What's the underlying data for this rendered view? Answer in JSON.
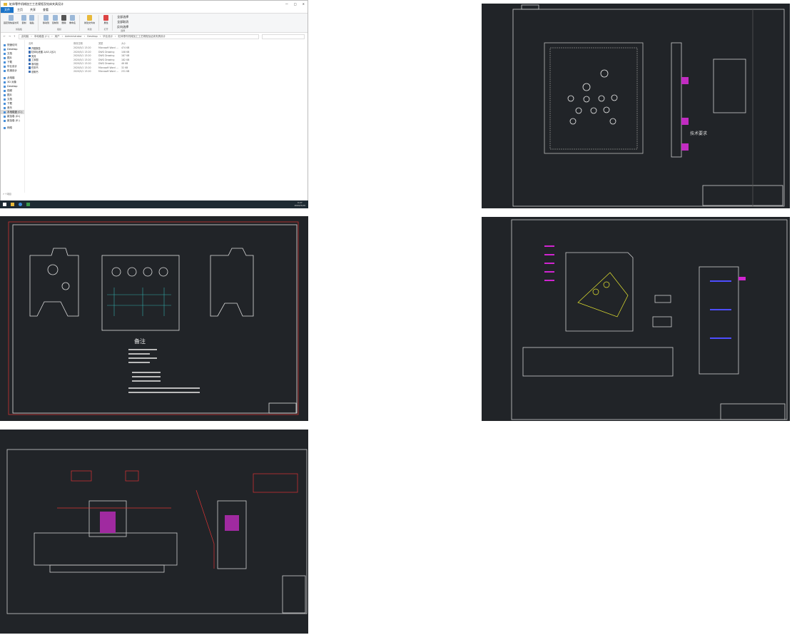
{
  "explorer": {
    "title": "缸体零件机械加工工艺规程及钻床夹具设计",
    "window_controls": [
      "—",
      "□",
      "✕"
    ],
    "menu": [
      "文件",
      "主页",
      "共享",
      "查看"
    ],
    "ribbon_groups": [
      {
        "label": "剪贴板",
        "buttons": [
          "固定到快速访问",
          "复制",
          "粘贴"
        ]
      },
      {
        "label": "组织",
        "buttons": [
          "移动到",
          "复制到",
          "删除",
          "重命名"
        ]
      },
      {
        "label": "新建",
        "buttons": [
          "新建文件夹"
        ]
      },
      {
        "label": "打开",
        "buttons": [
          "属性"
        ]
      },
      {
        "label": "选择",
        "buttons": [
          "全部选择",
          "全部取消",
          "反向选择"
        ]
      }
    ],
    "breadcrumb": [
      "此电脑",
      "本地磁盘 (C:)",
      "用户",
      "Administrator",
      "Desktop",
      "毕业设计"
    ],
    "nav": [
      "快速访问",
      "Desktop",
      "文档",
      "图片",
      "下载",
      "毕业设计",
      "机械设计",
      "此电脑",
      "3D 对象",
      "Desktop",
      "视频",
      "图片",
      "文档",
      "下载",
      "音乐",
      "本地磁盘 (C:)",
      "新加卷 (D:)",
      "新加卷 (E:)",
      "网络"
    ],
    "columns": [
      "名称",
      "修改日期",
      "类型",
      "大小"
    ],
    "files": [
      {
        "name": "开题报告",
        "date": "2020/5/1 13:20",
        "type": "Microsoft Word ...",
        "size": "474 KB"
      },
      {
        "name": "缸体毛坯图-1(A3,1比2)",
        "date": "2020/5/1 13:20",
        "type": "DWG Drawing",
        "size": "108 KB"
      },
      {
        "name": "夹具",
        "date": "2020/5/1 13:20",
        "type": "DWG Drawing",
        "size": "187 KB"
      },
      {
        "name": "工序图",
        "date": "2020/5/1 13:20",
        "type": "DWG Drawing",
        "size": "182 KB"
      },
      {
        "name": "零件图",
        "date": "2020/5/1 13:20",
        "type": "DWG Drawing",
        "size": "46 KB"
      },
      {
        "name": "任务书",
        "date": "2020/5/1 13:20",
        "type": "Microsoft Word ...",
        "size": "32 KB"
      },
      {
        "name": "说明书",
        "date": "2020/5/1 13:20",
        "type": "Microsoft Word ...",
        "size": "231 KB"
      }
    ],
    "status": "7 个项目",
    "clock": {
      "time": "9:27",
      "date": "2020/5/20"
    }
  },
  "drawings": {
    "plate_title": "技术要求",
    "notes_title": "备注"
  },
  "colors": {
    "cad_bg": "#212428",
    "accent": "#1a73c8"
  }
}
